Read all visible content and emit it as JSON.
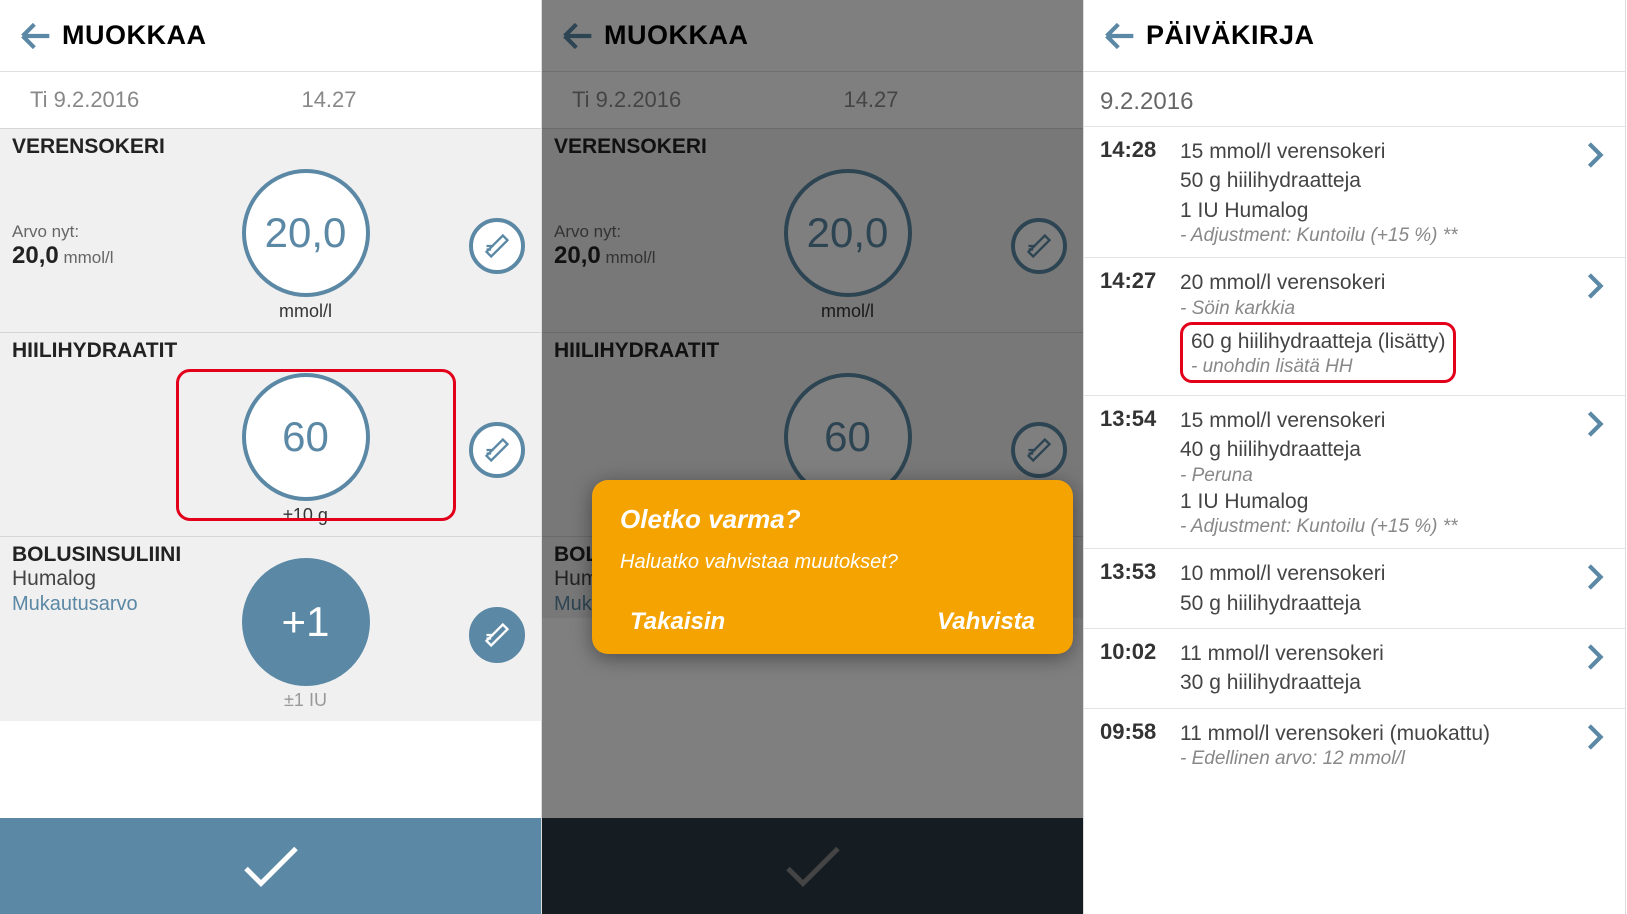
{
  "panel1": {
    "header": "MUOKKAA",
    "date": "Ti 9.2.2016",
    "time": "14.27",
    "bg": {
      "title": "VERENSOKERI",
      "value": "20,0",
      "unit": "mmol/l",
      "nowLabel": "Arvo nyt:",
      "nowVal": "20,0",
      "nowUnit": "mmol/l"
    },
    "carb": {
      "title": "HIILIHYDRAATIT",
      "value": "60",
      "unit": "±10 g"
    },
    "bolus": {
      "title": "BOLUSINSULIINI",
      "sub": "Humalog",
      "adjust": "Mukautusarvo",
      "value": "+1",
      "unit": "±1 IU"
    }
  },
  "panel2": {
    "header": "MUOKKAA",
    "date": "Ti 9.2.2016",
    "time": "14.27",
    "dialog": {
      "title": "Oletko varma?",
      "message": "Haluatko vahvistaa muutokset?",
      "back": "Takaisin",
      "confirm": "Vahvista"
    }
  },
  "panel3": {
    "header": "PÄIVÄKIRJA",
    "date": "9.2.2016",
    "entries": [
      {
        "time": "14:28",
        "lines": [
          "15 mmol/l verensokeri",
          "50 g hiilihydraatteja",
          "1 IU Humalog"
        ],
        "notes": [
          "Adjustment: Kuntoilu (+15 %) **"
        ]
      },
      {
        "time": "14:27",
        "lines": [
          "20 mmol/l verensokeri"
        ],
        "notes": [
          "Söin karkkia"
        ],
        "hl_lines": [
          "60 g hiilihydraatteja (lisätty)"
        ],
        "hl_notes": [
          "unohdin lisätä HH"
        ]
      },
      {
        "time": "13:54",
        "lines": [
          "15 mmol/l verensokeri",
          "40 g hiilihydraatteja"
        ],
        "notes": [
          "Peruna"
        ],
        "lines2": [
          "1 IU Humalog"
        ],
        "notes2": [
          "Adjustment: Kuntoilu (+15 %) **"
        ]
      },
      {
        "time": "13:53",
        "lines": [
          "10 mmol/l verensokeri",
          "50 g hiilihydraatteja"
        ]
      },
      {
        "time": "10:02",
        "lines": [
          "11 mmol/l verensokeri",
          "30 g hiilihydraatteja"
        ]
      },
      {
        "time": "09:58",
        "lines": [
          "11 mmol/l verensokeri (muokattu)"
        ],
        "notes": [
          "Edellinen arvo: 12 mmol/l"
        ]
      }
    ]
  }
}
